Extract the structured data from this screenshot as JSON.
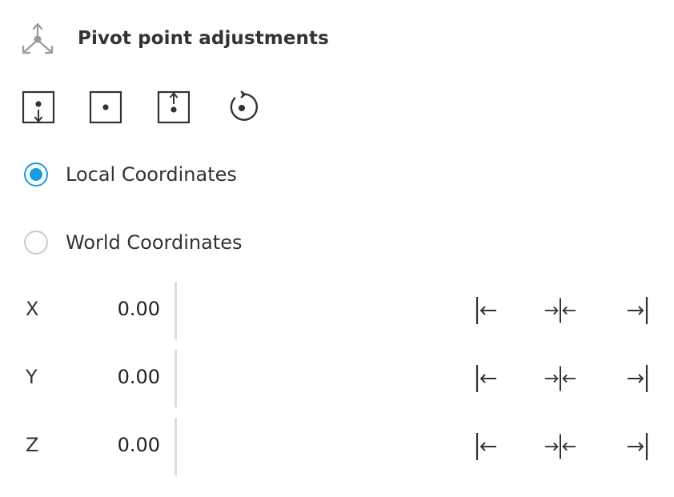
{
  "header": {
    "title": "Pivot point adjustments",
    "icon": "pivot-axes-icon"
  },
  "toolbar": {
    "buttons": [
      {
        "name": "pivot-bottom-button",
        "icon": "pivot-bottom-icon"
      },
      {
        "name": "pivot-center-button",
        "icon": "pivot-center-icon"
      },
      {
        "name": "pivot-top-button",
        "icon": "pivot-top-icon"
      },
      {
        "name": "pivot-reset-button",
        "icon": "rotate-reset-icon"
      }
    ]
  },
  "coordinates": {
    "options": [
      {
        "label": "Local Coordinates",
        "checked": true
      },
      {
        "label": "World Coordinates",
        "checked": false
      }
    ]
  },
  "axes": [
    {
      "label": "X",
      "value": "0.00"
    },
    {
      "label": "Y",
      "value": "0.00"
    },
    {
      "label": "Z",
      "value": "0.00"
    }
  ],
  "align_icons": [
    "align-min-icon",
    "align-center-icon",
    "align-max-icon"
  ],
  "colors": {
    "accent": "#1a9ce0",
    "text": "#333333",
    "icon_muted": "#9a9a9a",
    "divider": "#dddddd"
  }
}
